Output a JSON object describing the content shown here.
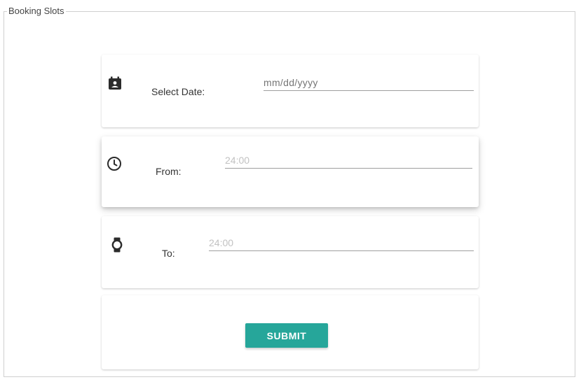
{
  "fieldset": {
    "legend": "Booking Slots"
  },
  "date_card": {
    "label": "Select Date:",
    "placeholder": "mm/dd/yyyy",
    "icon": "calendar-account-icon"
  },
  "from_card": {
    "label": "From:",
    "placeholder": "24:00",
    "icon": "clock-icon"
  },
  "to_card": {
    "label": "To:",
    "placeholder": "24:00",
    "icon": "watch-icon"
  },
  "submit": {
    "label": "SUBMIT",
    "color": "#26a69a"
  }
}
